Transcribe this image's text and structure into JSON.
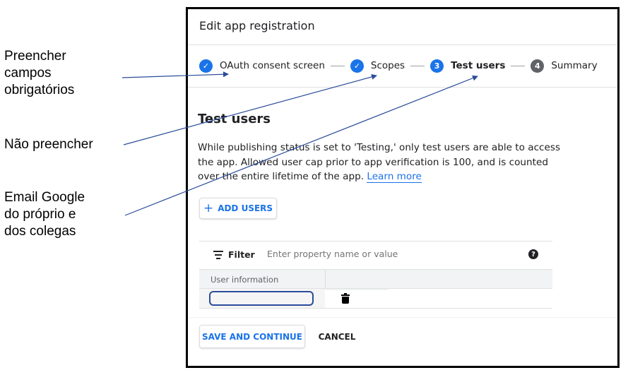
{
  "annotations": {
    "first": [
      "Preencher",
      "campos",
      "obrigatórios"
    ],
    "second": [
      "Não preencher"
    ],
    "third": [
      "Email Google",
      "do próprio e",
      "dos colegas"
    ],
    "arrow_color": "#2b4c9a"
  },
  "dialog": {
    "title": "Edit app registration",
    "steps": [
      {
        "number": "",
        "label": "OAuth consent screen",
        "state": "done"
      },
      {
        "number": "",
        "label": "Scopes",
        "state": "done"
      },
      {
        "number": "3",
        "label": "Test users",
        "state": "active"
      },
      {
        "number": "4",
        "label": "Summary",
        "state": "pending"
      }
    ],
    "check_mark": "✓",
    "section_title": "Test users",
    "description": "While publishing status is set to 'Testing,' only test users are able to access the app. Allowed user cap prior to app verification is 100, and is counted over the entire lifetime of the app.",
    "learn_more": "Learn more",
    "add_users_label": "ADD USERS",
    "add_users_icon": "+",
    "filter": {
      "label": "Filter",
      "placeholder": "Enter property name or value",
      "help_icon": "?"
    },
    "table": {
      "columns": [
        "User information"
      ],
      "rows": [
        {
          "user": ""
        }
      ]
    },
    "save_label": "SAVE AND CONTINUE",
    "cancel_label": "CANCEL",
    "accent_color": "#1a73e8"
  }
}
